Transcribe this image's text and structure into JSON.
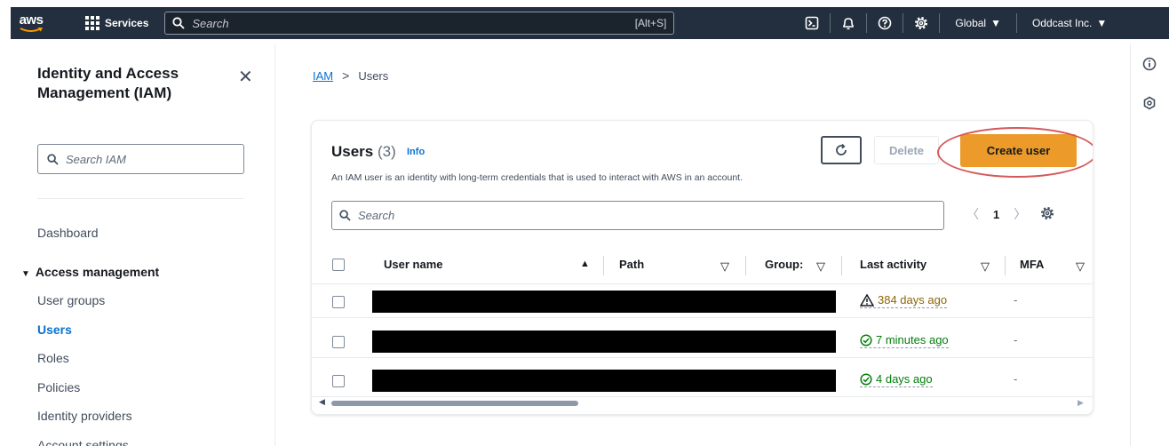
{
  "topnav": {
    "logo_text": "aws",
    "services_label": "Services",
    "search_placeholder": "Search",
    "search_shortcut": "[Alt+S]",
    "icons": [
      "cloudshell-icon",
      "bell-icon",
      "help-icon",
      "gear-icon"
    ],
    "region_label": "Global",
    "account_label": "Oddcast Inc."
  },
  "sidebar": {
    "title": "Identity and Access Management (IAM)",
    "close_glyph": "✕",
    "search_placeholder": "Search IAM",
    "dashboard_label": "Dashboard",
    "section_label": "Access management",
    "items": [
      {
        "label": "User groups",
        "active": false
      },
      {
        "label": "Users",
        "active": true
      },
      {
        "label": "Roles",
        "active": false
      },
      {
        "label": "Policies",
        "active": false
      },
      {
        "label": "Identity providers",
        "active": false
      },
      {
        "label": "Account settings",
        "active": false
      }
    ]
  },
  "breadcrumb": {
    "root": "IAM",
    "separator": ">",
    "current": "Users"
  },
  "users_panel": {
    "title": "Users",
    "count": "(3)",
    "info_label": "Info",
    "description": "An IAM user is an identity with long-term credentials that is used to interact with AWS in an account.",
    "delete_label": "Delete",
    "create_label": "Create user",
    "search_placeholder": "Search",
    "page_number": "1",
    "columns": {
      "user_name": "User name",
      "path": "Path",
      "groups": "Group:",
      "last_activity": "Last activity",
      "mfa": "MFA"
    },
    "rows": [
      {
        "last_activity": "384 days ago",
        "status": "warning",
        "mfa": "-"
      },
      {
        "last_activity": "7 minutes ago",
        "status": "ok",
        "mfa": "-"
      },
      {
        "last_activity": "4 days ago",
        "status": "ok",
        "mfa": "-"
      }
    ]
  },
  "colors": {
    "nav_bg": "#232f3e",
    "link": "#0972d3",
    "primary_button": "#ec9a2a",
    "warning": "#8d6605",
    "success": "#037f0c",
    "highlight_ring": "#d45a5a"
  }
}
